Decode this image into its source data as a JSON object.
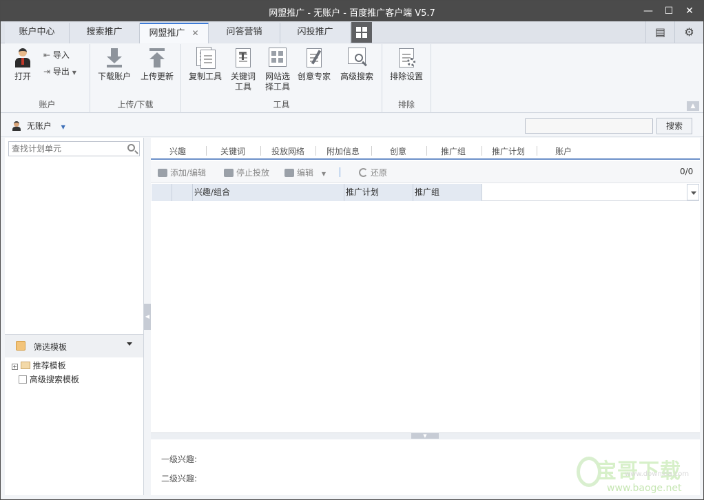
{
  "window": {
    "title": "网盟推广 - 无账户 - 百度推广客户端 V5.7"
  },
  "tabs": [
    {
      "label": "账户中心"
    },
    {
      "label": "搜索推广"
    },
    {
      "label": "网盟推广"
    },
    {
      "label": "问答营销"
    },
    {
      "label": "闪投推广"
    }
  ],
  "ribbon": {
    "account": {
      "open": "打开",
      "import": "导入",
      "export": "导出",
      "group": "账户"
    },
    "transfer": {
      "download": "下载账户",
      "upload": "上传更新",
      "group": "上传/下载"
    },
    "tools": {
      "copy": "复制工具",
      "keyword_1": "关键词",
      "keyword_2": "工具",
      "site_1": "网站选",
      "site_2": "择工具",
      "creative": "创意专家",
      "advsearch": "高级搜索",
      "group": "工具"
    },
    "exclude": {
      "settings": "排除设置",
      "group": "排除"
    }
  },
  "account_bar": {
    "name": "无账户",
    "search_value": "",
    "search_button": "搜索"
  },
  "left_panel": {
    "search_placeholder": "查找计划单元",
    "filter_title": "筛选模板",
    "tree": [
      "推荐模板",
      "高级搜索模板"
    ]
  },
  "subtabs": [
    "兴趣",
    "关键词",
    "投放网络",
    "附加信息",
    "创意",
    "推广组",
    "推广计划",
    "账户"
  ],
  "toolbar": {
    "add_edit": "添加/编辑",
    "stop": "停止投放",
    "edit": "编辑",
    "restore": "还原",
    "count": "0/0"
  },
  "grid": {
    "columns": [
      "兴趣/组合",
      "推广计划",
      "推广组"
    ]
  },
  "detail": {
    "level1": "一级兴趣:",
    "level2": "二级兴趣:"
  },
  "watermark": {
    "brand": "宝哥下载",
    "small": "www.downxia.com",
    "url": "www.baoge.net"
  }
}
